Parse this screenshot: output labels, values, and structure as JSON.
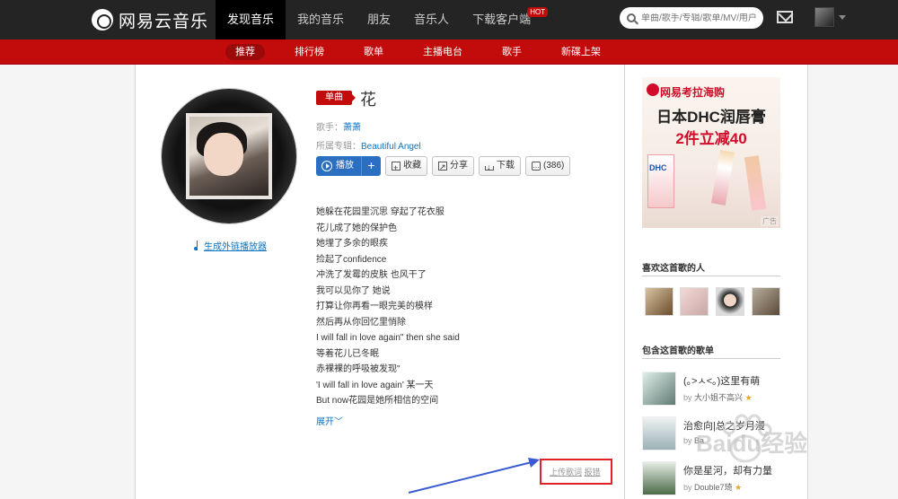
{
  "header": {
    "logo_text": "网易云音乐",
    "nav": [
      {
        "label": "发现音乐",
        "active": true
      },
      {
        "label": "我的音乐"
      },
      {
        "label": "朋友"
      },
      {
        "label": "音乐人"
      },
      {
        "label": "下载客户端",
        "badge": "HOT"
      }
    ],
    "search_placeholder": "单曲/歌手/专辑/歌单/MV/用户"
  },
  "subnav": [
    "推荐",
    "排行榜",
    "歌单",
    "主播电台",
    "歌手",
    "新碟上架"
  ],
  "song": {
    "badge": "单曲",
    "title": "花",
    "singer_label": "歌手：",
    "singer": "萧萧",
    "album_label": "所属专辑：",
    "album": "Beautiful Angel",
    "buttons": {
      "play": "播放",
      "plus": "+",
      "favorite": "收藏",
      "share": "分享",
      "download": "下载",
      "comment": "(386)"
    },
    "external_player_link": "生成外链播放器"
  },
  "lyrics": [
    "她躲在花园里沉思 穿起了花衣服",
    "花儿成了她的保护色",
    "她埋了多余的眼疾",
    "捡起了confidence",
    "冲洗了发霉的皮肤 也风干了",
    "我可以见你了 她说",
    "打算让你再看一眼完美的模样",
    "然后再从你回忆里悄除",
    "I will fall in love again\" then she said",
    "等着花儿已冬眠",
    "赤裸裸的呼吸被发现\"",
    "'I will fall in love again' 某一天",
    "But now花园是她所相信的空间"
  ],
  "expand_label": "展开",
  "lyric_actions": {
    "upload": "上传歌词",
    "report": "报错"
  },
  "ad": {
    "brand": "网易考拉海购",
    "line1": "日本DHC润唇膏",
    "line2": "2件立减40",
    "product_mark": "DHC",
    "tag": "广告"
  },
  "sidebar": {
    "likers_title": "喜欢这首歌的人",
    "playlists_title": "包含这首歌的歌单",
    "playlists": [
      {
        "name": "(｡>ㅅ<｡)这里有萌",
        "by": "by",
        "user": "大小姐不高兴"
      },
      {
        "name": "治愈向|总之岁月漫",
        "by": "by",
        "user": "Ba"
      },
      {
        "name": "你是星河，却有力量",
        "by": "by",
        "user": "Double7琦"
      }
    ]
  },
  "watermark": "Baidu经验",
  "colors": {
    "brand_red": "#c20c0c",
    "topbar": "#242424",
    "link_blue": "#0c73c2",
    "highlight_box": "#e0202b",
    "annotation_arrow": "#3a5bd1"
  }
}
